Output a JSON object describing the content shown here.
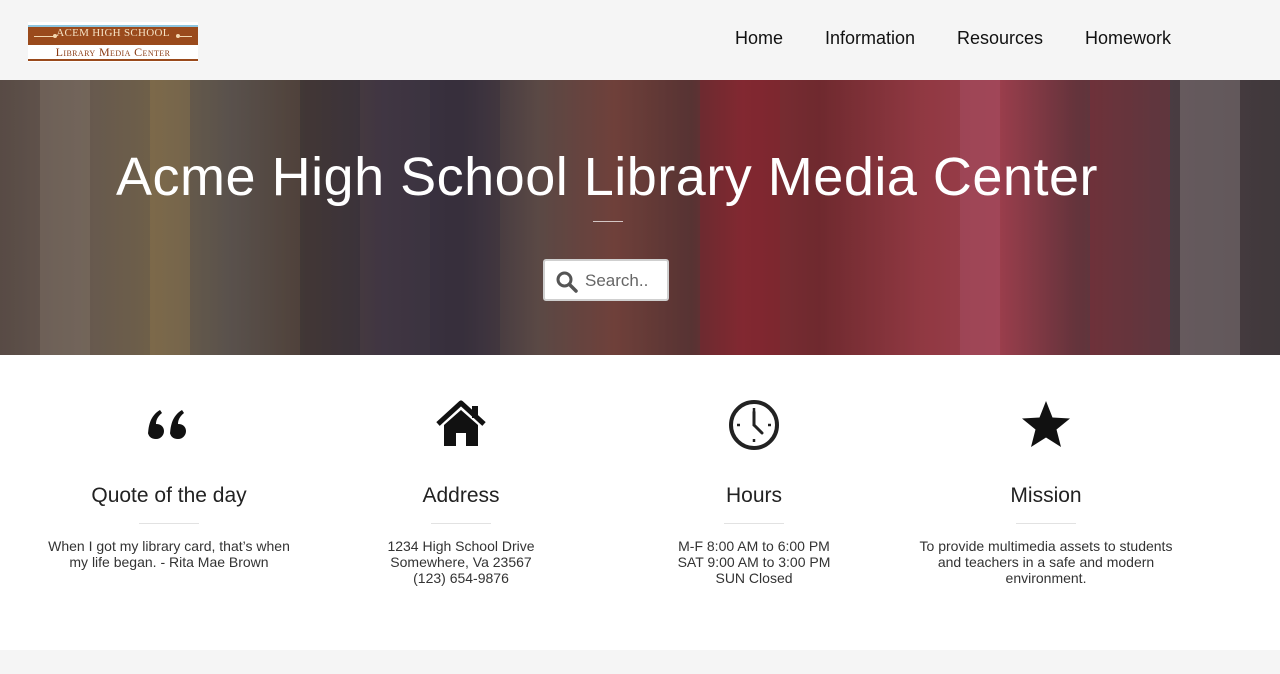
{
  "header": {
    "logo": {
      "line1": "ACEM HIGH SCHOOL",
      "line2": "Library Media Center"
    },
    "nav": [
      "Home",
      "Information",
      "Resources",
      "Homework"
    ]
  },
  "hero": {
    "title": "Acme High School Library Media Center",
    "search": {
      "placeholder": "Search.."
    }
  },
  "features": [
    {
      "icon": "quote-icon",
      "heading": "Quote of the day",
      "lines": [
        "When I got my library card, that’s when",
        "my life began. - Rita Mae Brown"
      ]
    },
    {
      "icon": "home-icon",
      "heading": "Address",
      "lines": [
        "1234 High School Drive",
        "Somewhere, Va 23567",
        "(123) 654-9876"
      ]
    },
    {
      "icon": "clock-icon",
      "heading": "Hours",
      "lines": [
        "M-F 8:00 AM to 6:00 PM",
        "SAT 9:00 AM to 3:00 PM",
        "SUN Closed"
      ]
    },
    {
      "icon": "star-icon",
      "heading": "Mission",
      "lines": [
        "To provide multimedia assets to students",
        "and teachers in a safe and modern",
        "environment."
      ]
    }
  ],
  "colors": {
    "header_bg": "#f5f5f5",
    "logo_brown": "#9a4a1c",
    "logo_blue": "#8ec6e0",
    "hero_text": "#ffffff"
  }
}
